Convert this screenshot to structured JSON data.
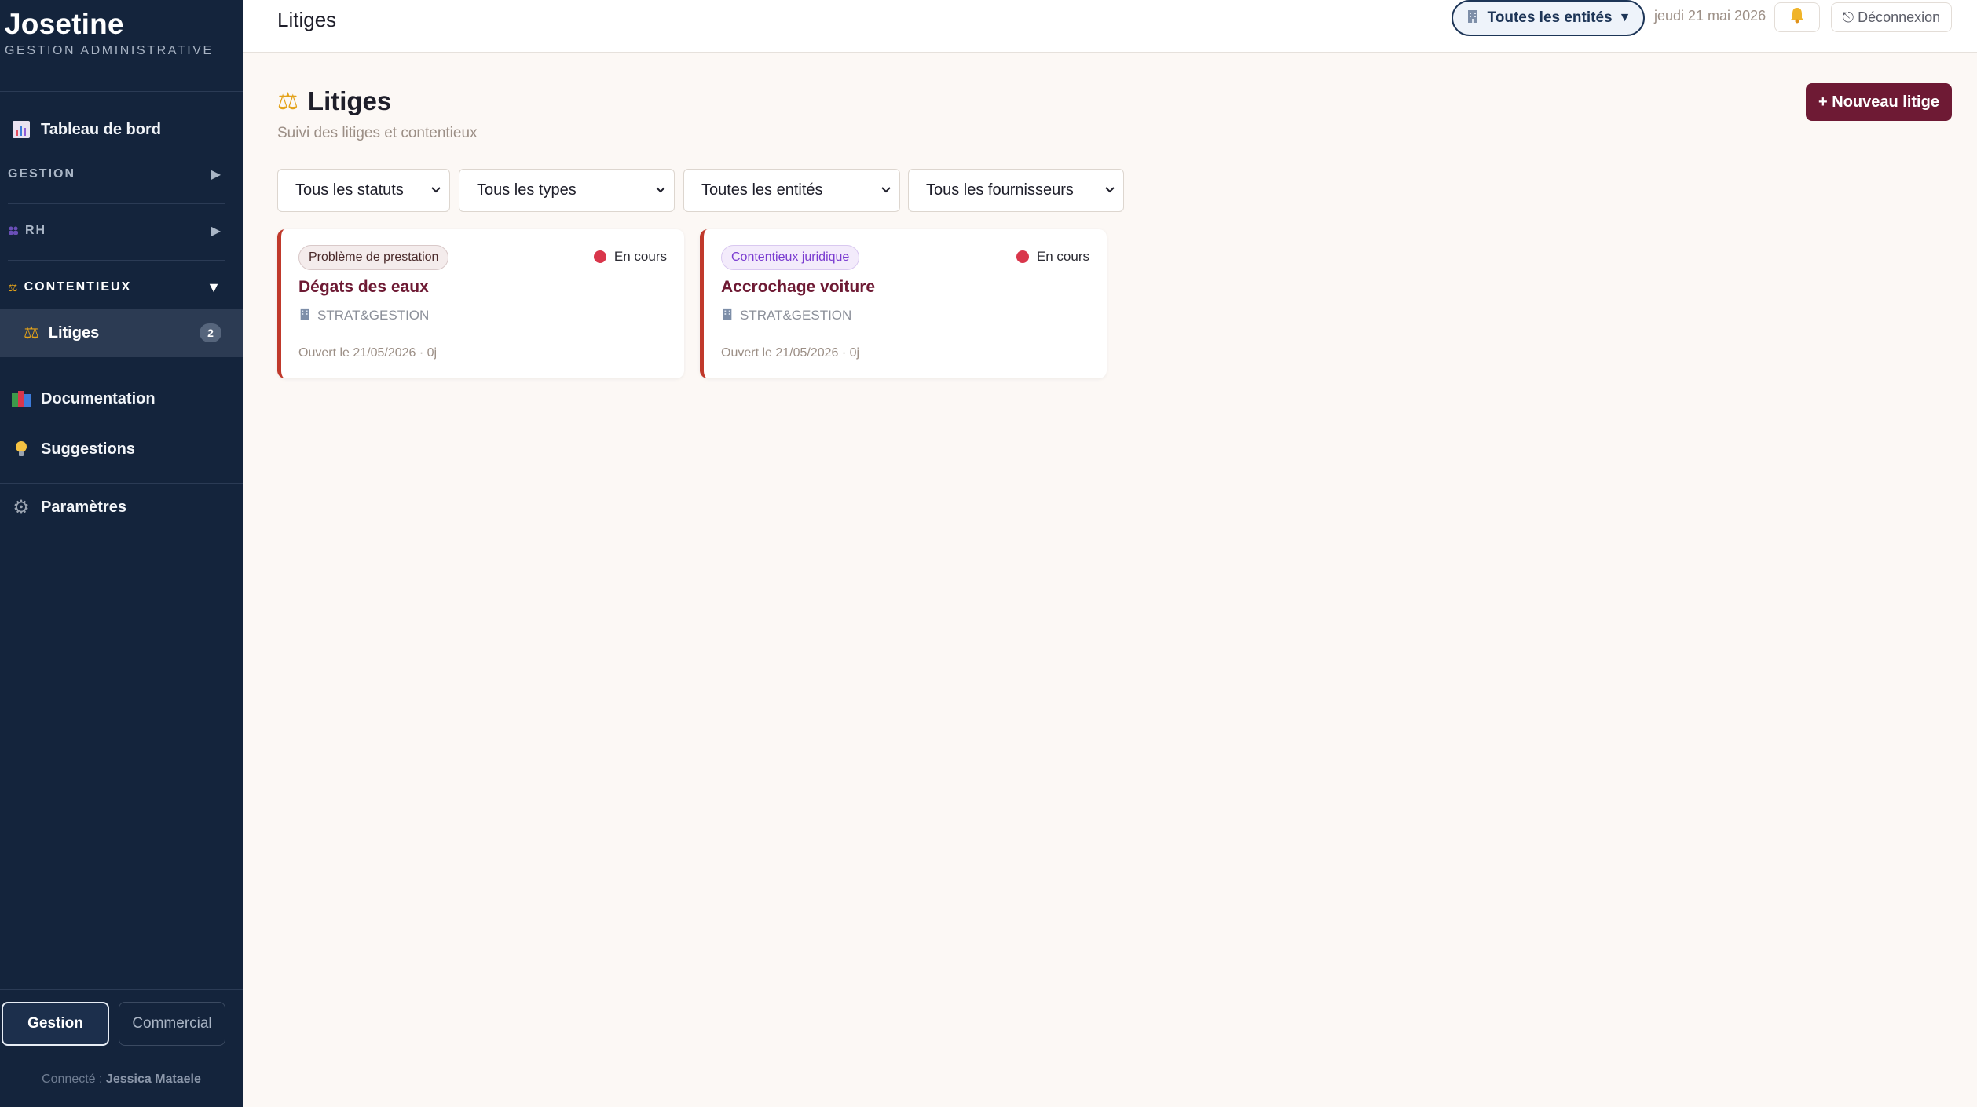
{
  "sidebar": {
    "brand_title": "Josetine",
    "brand_subtitle": "GESTION ADMINISTRATIVE",
    "dashboard_label": "Tableau de bord",
    "section_gestion": "GESTION",
    "section_rh": "RH",
    "section_contentieux": "CONTENTIEUX",
    "litiges_label": "Litiges",
    "litiges_count": "2",
    "documentation_label": "Documentation",
    "suggestions_label": "Suggestions",
    "parametres_label": "Paramètres",
    "mode_gestion": "Gestion",
    "mode_commercial": "Commercial",
    "connected_prefix": "Connecté :",
    "connected_user": "Jessica Mataele"
  },
  "topbar": {
    "title": "Litiges",
    "entity_selector": "Toutes les entités",
    "entity_arrow": "▼",
    "date": "jeudi 21 mai 2026",
    "logout": "⎋ Déconnexion"
  },
  "main": {
    "heading": "Litiges",
    "subtitle": "Suivi des litiges et contentieux",
    "new_button": "+ Nouveau litige",
    "filters": {
      "statut": "Tous les statuts",
      "type": "Tous les types",
      "entite": "Toutes les entités",
      "fournisseur": "Tous les fournisseurs"
    },
    "cards": [
      {
        "tag": "Problème de prestation",
        "status": "En cours",
        "title": "Dégats des eaux",
        "entity": "STRAT&GESTION",
        "footer": "Ouvert le 21/05/2026 · 0j"
      },
      {
        "tag": "Contentieux juridique",
        "status": "En cours",
        "title": "Accrochage voiture",
        "entity": "STRAT&GESTION",
        "footer": "Ouvert le 21/05/2026 · 0j"
      }
    ]
  },
  "colors": {
    "sidebar_bg": "#14243c",
    "accent": "#6e1a34",
    "status_dot": "#d9364b",
    "card_border": "#c0392b"
  }
}
